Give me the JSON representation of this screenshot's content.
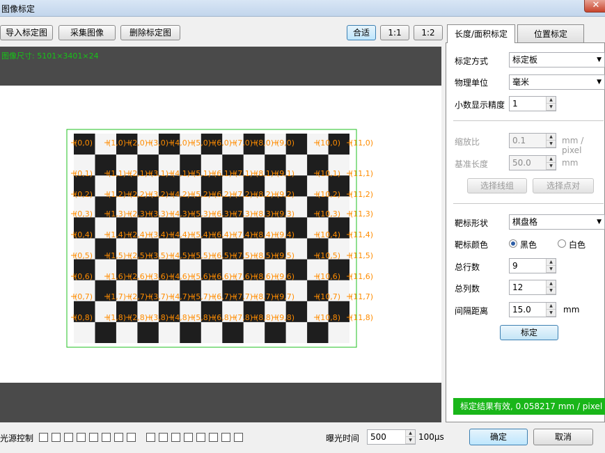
{
  "window": {
    "title": "图像标定",
    "close_glyph": "✕"
  },
  "toolbar": {
    "import_label": "导入标定图",
    "capture_label": "采集图像",
    "delete_label": "删除标定图",
    "fit_label": "合适",
    "zoom_1_1_label": "1:1",
    "zoom_1_2_label": "1:2"
  },
  "viewer": {
    "image_size_label": "图像尺寸: 5101×3401×24",
    "grid_rows": 9,
    "grid_cols": 12,
    "point_labels": [
      [
        "(0,0)",
        "(1,0)",
        "(2,0)",
        "(3,0)",
        "(4,0)",
        "(5,0)",
        "(6,0)",
        "(7,0)",
        "(8,0)",
        "(9,0)",
        "(10,0)",
        "(11,0)"
      ],
      [
        "(0,1)",
        "(1,1)",
        "(2,1)",
        "(3,1)",
        "(4,1)",
        "(5,1)",
        "(6,1)",
        "(7,1)",
        "(8,1)",
        "(9,1)",
        "(10,1)",
        "(11,1)"
      ],
      [
        "(0,2)",
        "(1,2)",
        "(2,2)",
        "(3,2)",
        "(4,2)",
        "(5,2)",
        "(6,2)",
        "(7,2)",
        "(8,2)",
        "(9,2)",
        "(10,2)",
        "(11,2)"
      ],
      [
        "(0,3)",
        "(1,3)",
        "(2,3)",
        "(3,3)",
        "(4,3)",
        "(5,3)",
        "(6,3)",
        "(7,3)",
        "(8,3)",
        "(9,3)",
        "(10,3)",
        "(11,3)"
      ],
      [
        "(0,4)",
        "(1,4)",
        "(2,4)",
        "(3,4)",
        "(4,4)",
        "(5,4)",
        "(6,4)",
        "(7,4)",
        "(8,4)",
        "(9,4)",
        "(10,4)",
        "(11,4)"
      ],
      [
        "(0,5)",
        "(1,5)",
        "(2,5)",
        "(3,5)",
        "(4,5)",
        "(5,5)",
        "(6,5)",
        "(7,5)",
        "(8,5)",
        "(9,5)",
        "(10,5)",
        "(11,5)"
      ],
      [
        "(0,6)",
        "(1,6)",
        "(2,6)",
        "(3,6)",
        "(4,6)",
        "(5,6)",
        "(6,6)",
        "(7,6)",
        "(8,6)",
        "(9,6)",
        "(10,6)",
        "(11,6)"
      ],
      [
        "(0,7)",
        "(1,7)",
        "(2,7)",
        "(3,7)",
        "(4,7)",
        "(5,7)",
        "(6,7)",
        "(7,7)",
        "(8,7)",
        "(9,7)",
        "(10,7)",
        "(11,7)"
      ],
      [
        "(0,8)",
        "(1,8)",
        "(2,8)",
        "(3,8)",
        "(4,8)",
        "(5,8)",
        "(6,8)",
        "(7,8)",
        "(8,8)",
        "(9,8)",
        "(10,8)",
        "(11,8)"
      ]
    ],
    "label_color": "#ff8c00",
    "roi_color": "#22c022"
  },
  "tabs": {
    "length_area": "长度/面积标定",
    "position": "位置标定"
  },
  "panel": {
    "method_label": "标定方式",
    "method_value": "标定板",
    "unit_label": "物理单位",
    "unit_value": "毫米",
    "decimal_label": "小数显示精度",
    "decimal_value": "1",
    "scale_label": "缩放比",
    "scale_value": "0.1",
    "scale_unit": "mm / pixel",
    "base_length_label": "基准长度",
    "base_length_value": "50.0",
    "base_length_unit": "mm",
    "select_line_label": "选择线组",
    "select_point_label": "选择点对",
    "target_shape_label": "靶标形状",
    "target_shape_value": "棋盘格",
    "target_color_label": "靶标颜色",
    "color_black": "黑色",
    "color_white": "白色",
    "rows_label": "总行数",
    "rows_value": "9",
    "cols_label": "总列数",
    "cols_value": "12",
    "spacing_label": "间隔距离",
    "spacing_value": "15.0",
    "spacing_unit": "mm",
    "calibrate_label": "标定",
    "result_text": "标定结果有效, 0.058217 mm / pixel",
    "result_color": "#19b619"
  },
  "bottom": {
    "light_label": "光源控制",
    "exposure_label": "曝光时间",
    "exposure_value": "500",
    "exposure_unit": "100μs",
    "ok_label": "确定",
    "cancel_label": "取消"
  }
}
